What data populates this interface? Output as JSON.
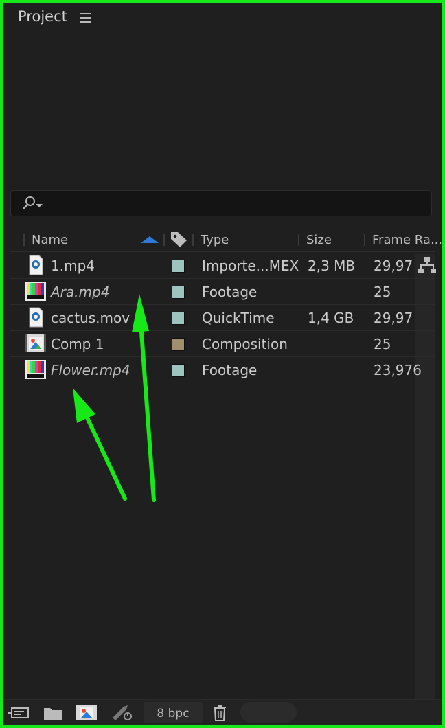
{
  "panel": {
    "title": "Project"
  },
  "columns": {
    "name": "Name",
    "type": "Type",
    "size": "Size",
    "frame_rate": "Frame Ra..."
  },
  "items": [
    {
      "name": "1.mp4",
      "italic": false,
      "icon": "quicktime-file-icon",
      "label_color": "#9ec4c0",
      "type": "Importe...MEX",
      "size": "2,3 MB",
      "frame_rate": "29,97"
    },
    {
      "name": "Ara.mp4",
      "italic": true,
      "icon": "color-bars-footage-icon",
      "label_color": "#9ec4c0",
      "type": "Footage",
      "size": "",
      "frame_rate": "25"
    },
    {
      "name": "cactus.mov",
      "italic": false,
      "icon": "quicktime-file-icon",
      "label_color": "#9ec4c0",
      "type": "QuickTime",
      "size": "1,4 GB",
      "frame_rate": "29,97"
    },
    {
      "name": "Comp 1",
      "italic": false,
      "icon": "composition-icon",
      "label_color": "#a08e6c",
      "type": "Composition",
      "size": "",
      "frame_rate": "25"
    },
    {
      "name": "Flower.mp4",
      "italic": true,
      "icon": "color-bars-footage-icon",
      "label_color": "#9ec4c0",
      "type": "Footage",
      "size": "",
      "frame_rate": "23,976"
    }
  ],
  "bottom_bar": {
    "bpc": "8 bpc"
  },
  "colors": {
    "accent_sort": "#2f7ad6",
    "annotation": "#17e817",
    "background": "#1f1f1f"
  }
}
